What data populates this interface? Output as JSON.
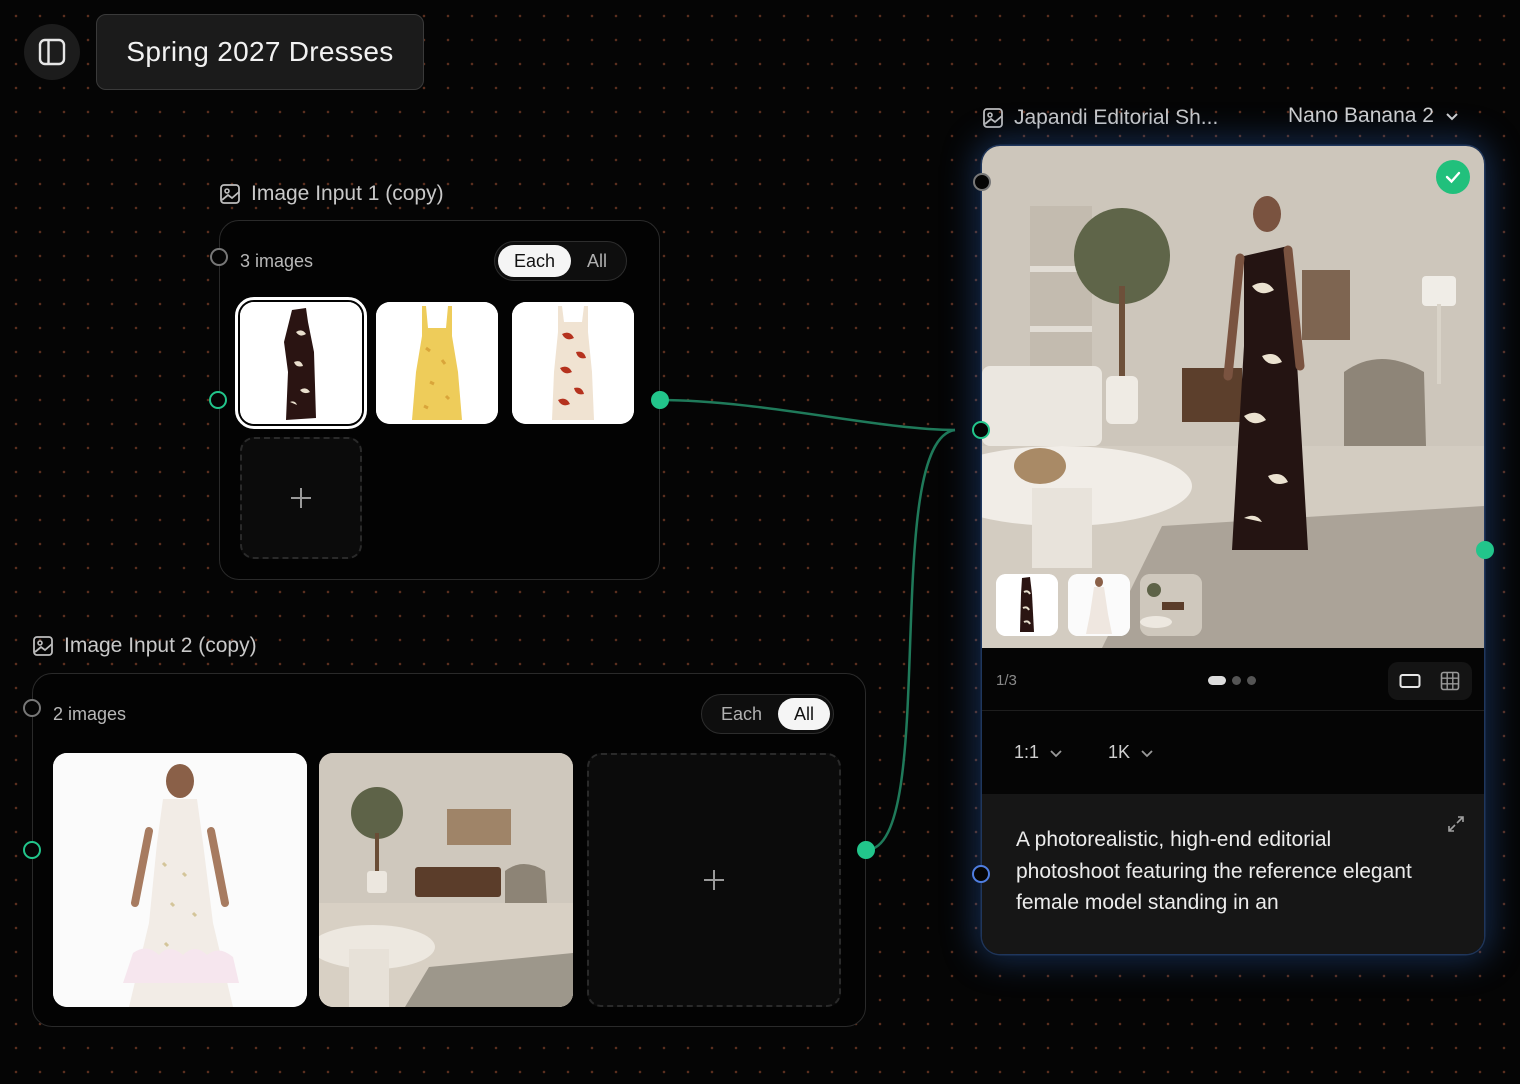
{
  "project": {
    "title": "Spring 2027 Dresses"
  },
  "node1": {
    "title": "Image Input 1 (copy)",
    "count": "3 images",
    "mode_each": "Each",
    "mode_all": "All",
    "active_mode": "Each",
    "images": [
      "black floral dress",
      "yellow floral dress",
      "red floral dress"
    ]
  },
  "node2": {
    "title": "Image Input 2 (copy)",
    "count": "2 images",
    "mode_each": "Each",
    "mode_all": "All",
    "active_mode": "All",
    "images": [
      "white halter dress model",
      "japandi living room"
    ]
  },
  "output": {
    "title": "Japandi Editorial Sh...",
    "model": "Nano Banana 2",
    "page": "1/3",
    "aspect": "1:1",
    "resolution": "1K",
    "prompt": "A photorealistic, high-end editorial photoshoot featuring the reference elegant female model standing in an",
    "status": "complete"
  },
  "colors": {
    "accent_green": "#22c58b",
    "edge": "#1f7a5a",
    "glow_blue": "#2a5aa8"
  }
}
